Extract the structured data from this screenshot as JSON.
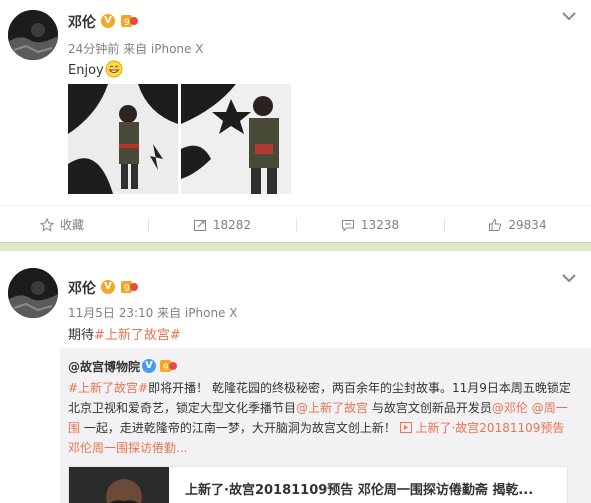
{
  "colors": {
    "accent": "#eb7350",
    "badge_orange": "#f5a623",
    "feed_gap": "#dce7c8",
    "repost_bg": "#f2f2f5"
  },
  "post1": {
    "author": "邓伦",
    "meta": "24分钟前 来自 iPhone X",
    "text": "Enjoy",
    "emoji": "smile-emoji",
    "actions": {
      "favorite": "收藏",
      "repost": "18282",
      "comment": "13238",
      "like": "29834"
    }
  },
  "post2": {
    "author": "邓伦",
    "meta": "11月5日 23:10 来自 iPhone X",
    "text_prefix": "期待",
    "topic": "#上新了故宫#",
    "repost": {
      "author": "@故宫博物院",
      "topic": "#上新了故宫#",
      "line1_rest": "即将开播！ 乾隆花园的终极秘密，两百余年的尘封故事。11月9日本周五晚锁定",
      "line2_a": "北京卫视和爱奇艺，锁定大型文化季播节目",
      "line2_link1": "@上新了故宫",
      "line2_b": " 与故宫文创新品开发员",
      "line2_link2": "@邓伦",
      "line2_space": " ",
      "line2_link3": "@周一",
      "line3_link": "围",
      "line3_rest": " 一起，走进乾隆帝的江南一梦，大开脑洞为故宫文创上新！ ",
      "video_link": "上新了·故宫20181109预告",
      "line4": "邓伦周一围探访倦勤...",
      "card_title": "上新了·故宫20181109预告 邓伦周一围探访倦勤斋 揭乾..."
    }
  }
}
